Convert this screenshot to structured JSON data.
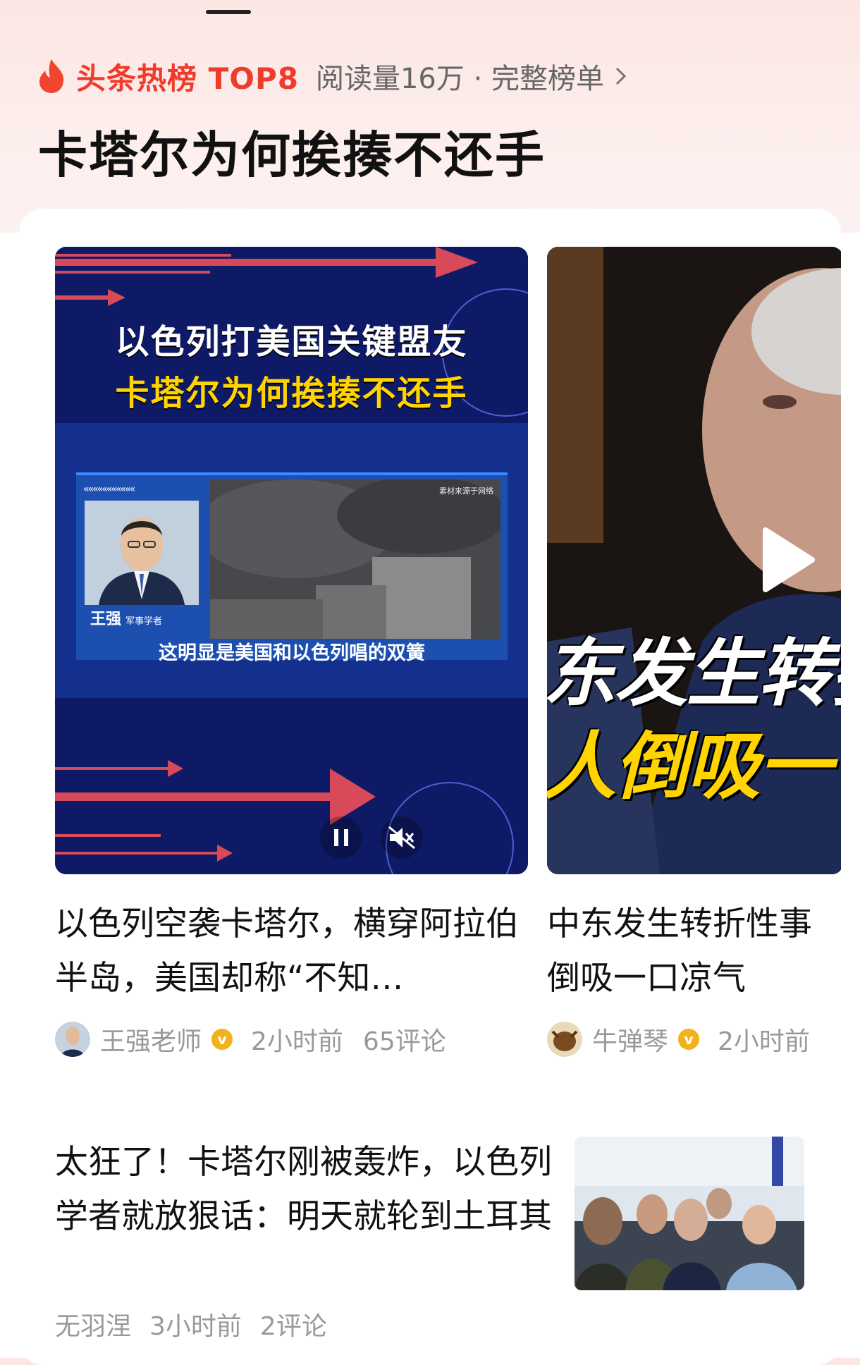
{
  "hot_list": {
    "title": "头条热榜 TOP8",
    "meta": "阅读量16万 · 完整榜单",
    "headline": "卡塔尔为何挨揍不还手"
  },
  "video1": {
    "overlay_line1": "以色列打美国关键盟友",
    "overlay_line2": "卡塔尔为何挨揍不还手",
    "source_note": "素材来源于网络",
    "guest_name": "王强",
    "guest_role": "军事学者",
    "subtitle": "这明显是美国和以色列唱的双簧",
    "title": "以色列空袭卡塔尔，横穿阿拉伯半岛，美国却称“不知…",
    "author": "王强老师",
    "time": "2小时前",
    "comments": "65评论"
  },
  "video2": {
    "overlay_line1": "东发生转折",
    "overlay_line2": "人倒吸一",
    "title_line1": "中东发生转折性事",
    "title_line2": "倒吸一口凉气",
    "author": "牛弹琴",
    "time": "2小时前"
  },
  "news": {
    "title": "太狂了！卡塔尔刚被轰炸，以色列学者就放狠话：明天就轮到土耳其",
    "author": "无羽涅",
    "time": "3小时前",
    "comments": "2评论"
  },
  "colors": {
    "accent": "#ef3b2c",
    "verified": "#f2b21b",
    "video_bg": "#0f1a66"
  }
}
